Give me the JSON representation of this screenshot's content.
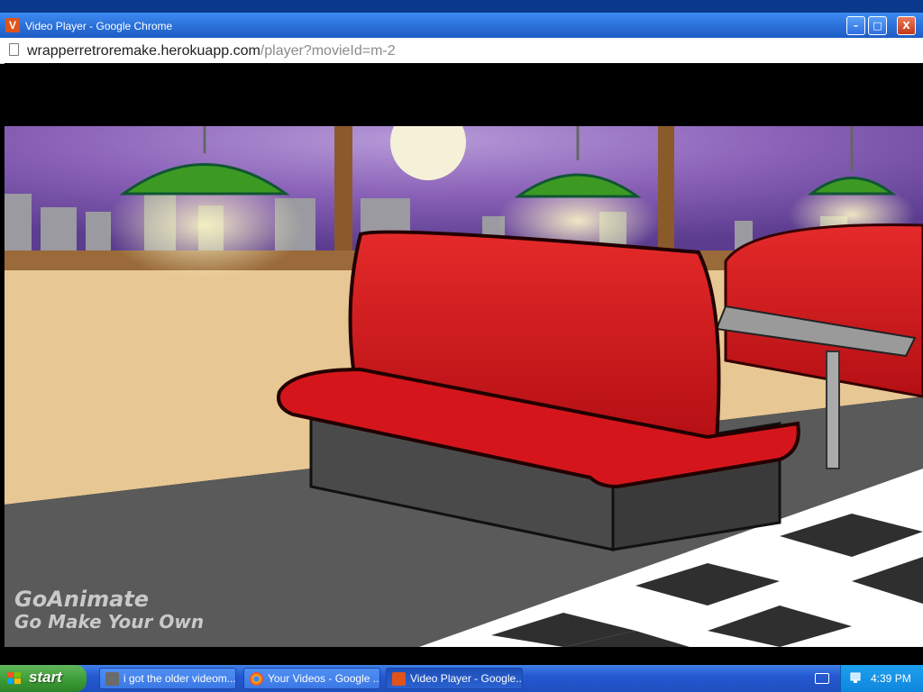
{
  "window": {
    "title": "Video Player - Google Chrome",
    "app_icon_letter": "V",
    "controls": {
      "minimize": "–",
      "maximize": "□",
      "close": "X"
    }
  },
  "address_bar": {
    "host": "wrapperretroremake.herokuapp.com",
    "path": "/player?movieId=m-2"
  },
  "video": {
    "watermark_line1": "GoAnimate",
    "watermark_line2": "Go Make Your Own"
  },
  "taskbar": {
    "start_label": "start",
    "tasks": [
      {
        "label": "i got the older videom...",
        "icon": "raccoon-icon"
      },
      {
        "label": "Your Videos - Google ...",
        "icon": "chrome-icon"
      },
      {
        "label": "Video Player - Google...",
        "icon": "videoplayer-icon",
        "active": true
      }
    ],
    "clock": "4:39 PM"
  },
  "colors": {
    "titlebar": "#2a6fd8",
    "taskbar": "#2459d1",
    "start": "#3a9a34",
    "booth_red": "#d4161c",
    "lamp_green": "#3c9a22",
    "sky_purple": "#8a62b8"
  }
}
